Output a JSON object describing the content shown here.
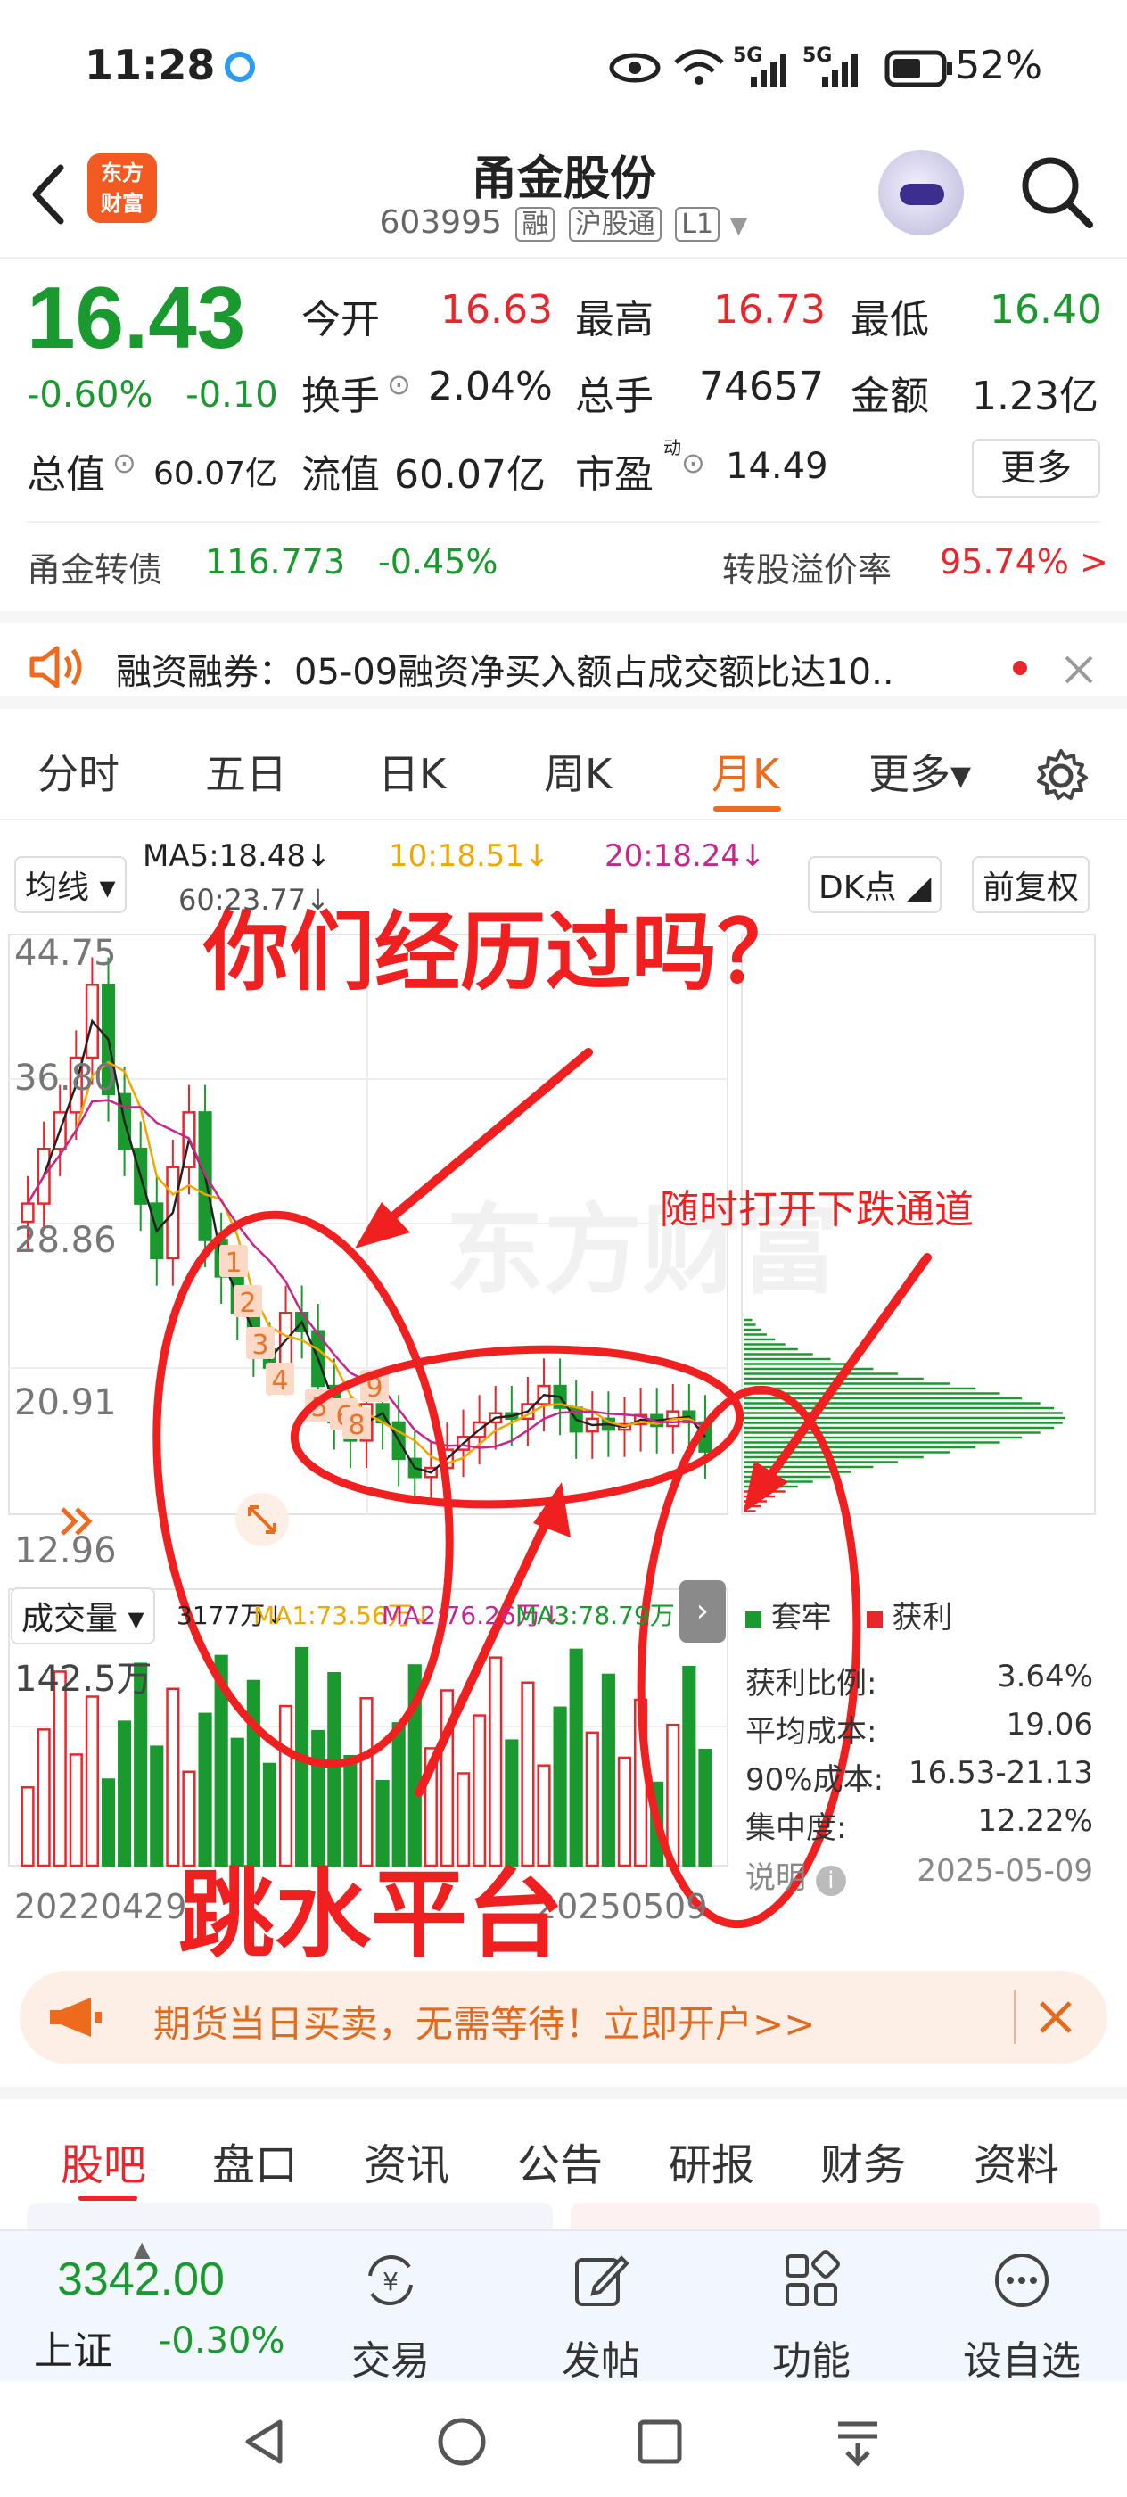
{
  "status_bar": {
    "time": "11:28",
    "network": "5G",
    "battery": "52%"
  },
  "header": {
    "logo_text_1": "东方",
    "logo_text_2": "财富",
    "stock_name": "甬金股份",
    "stock_code": "603995",
    "tags": [
      "融",
      "沪股通",
      "L1"
    ]
  },
  "quote": {
    "price": "16.43",
    "change_pct": "-0.60%",
    "change_abs": "-0.10",
    "open_label": "今开",
    "open": "16.63",
    "high_label": "最高",
    "high": "16.73",
    "low_label": "最低",
    "low": "16.40",
    "turnover_label": "换手",
    "turnover": "2.04%",
    "volume_label": "总手",
    "volume": "74657",
    "amount_label": "金额",
    "amount": "1.23亿",
    "mcap_label": "总值",
    "mcap": "60.07亿",
    "float_label": "流值",
    "float_mcap": "60.07亿",
    "pe_label": "市盈",
    "pe_sup": "动",
    "pe": "14.49",
    "more_label": "更多",
    "bond_name": "甬金转债",
    "bond_price": "116.773",
    "bond_change": "-0.45%",
    "premium_label": "转股溢价率",
    "premium": "95.74% >"
  },
  "notice": {
    "text": "融资融券：05-09融资净买入额占成交额比达10.."
  },
  "tabs": [
    "分时",
    "五日",
    "日K",
    "周K",
    "月K",
    "更多▾"
  ],
  "active_tab": "月K",
  "chart": {
    "ma_selector": "均线",
    "ma5": "MA5:18.48↓",
    "ma10": "10:18.51↓",
    "ma20": "20:18.24↓",
    "ma60": "60:23.77↓",
    "dk_label": "DK点",
    "adjust_label": "前复权",
    "y_labels": [
      "44.75",
      "36.80",
      "28.86",
      "20.91",
      "12.96"
    ],
    "volume_selector": "成交量",
    "vol_legend_1": "3177万↓",
    "vol_legend_2": "MA1:73.56万↓",
    "vol_legend_3": "MA2:76.26万↓",
    "vol_legend_4": "MA3:78.79万↓",
    "vol_max": "142.5万",
    "date_start": "20220429",
    "date_end": "20250509",
    "watermark": "东方财富",
    "numbered_markers": [
      "1",
      "2",
      "3",
      "4",
      "5",
      "6",
      "8",
      "9"
    ]
  },
  "chip_panel": {
    "legend_trapped": "套牢",
    "legend_profit": "获利",
    "rows": [
      {
        "label": "获利比例:",
        "value": "3.64%"
      },
      {
        "label": "平均成本:",
        "value": "19.06"
      },
      {
        "label": "90%成本:",
        "value": "16.53-21.13"
      },
      {
        "label": "集中度:",
        "value": "12.22%"
      }
    ],
    "note_label": "说明",
    "date": "2025-05-09"
  },
  "annotations": {
    "title": "你们经历过吗？",
    "side": "随时打开下跌通道",
    "bottom": "跳水平台"
  },
  "ad": {
    "text": "期货当日买卖，无需等待！立即开户>>"
  },
  "bottom_tabs": [
    "股吧",
    "盘口",
    "资讯",
    "公告",
    "研报",
    "财务",
    "资料"
  ],
  "active_bottom_tab": "股吧",
  "dock": {
    "index_value": "3342.00",
    "index_name": "上证",
    "index_change": "-0.30%",
    "items": [
      "交易",
      "发帖",
      "功能",
      "设自选"
    ]
  },
  "colors": {
    "up": "#e8262b",
    "down": "#1a9a2e",
    "accent": "#ee6b1e",
    "annot": "#f02020"
  }
}
